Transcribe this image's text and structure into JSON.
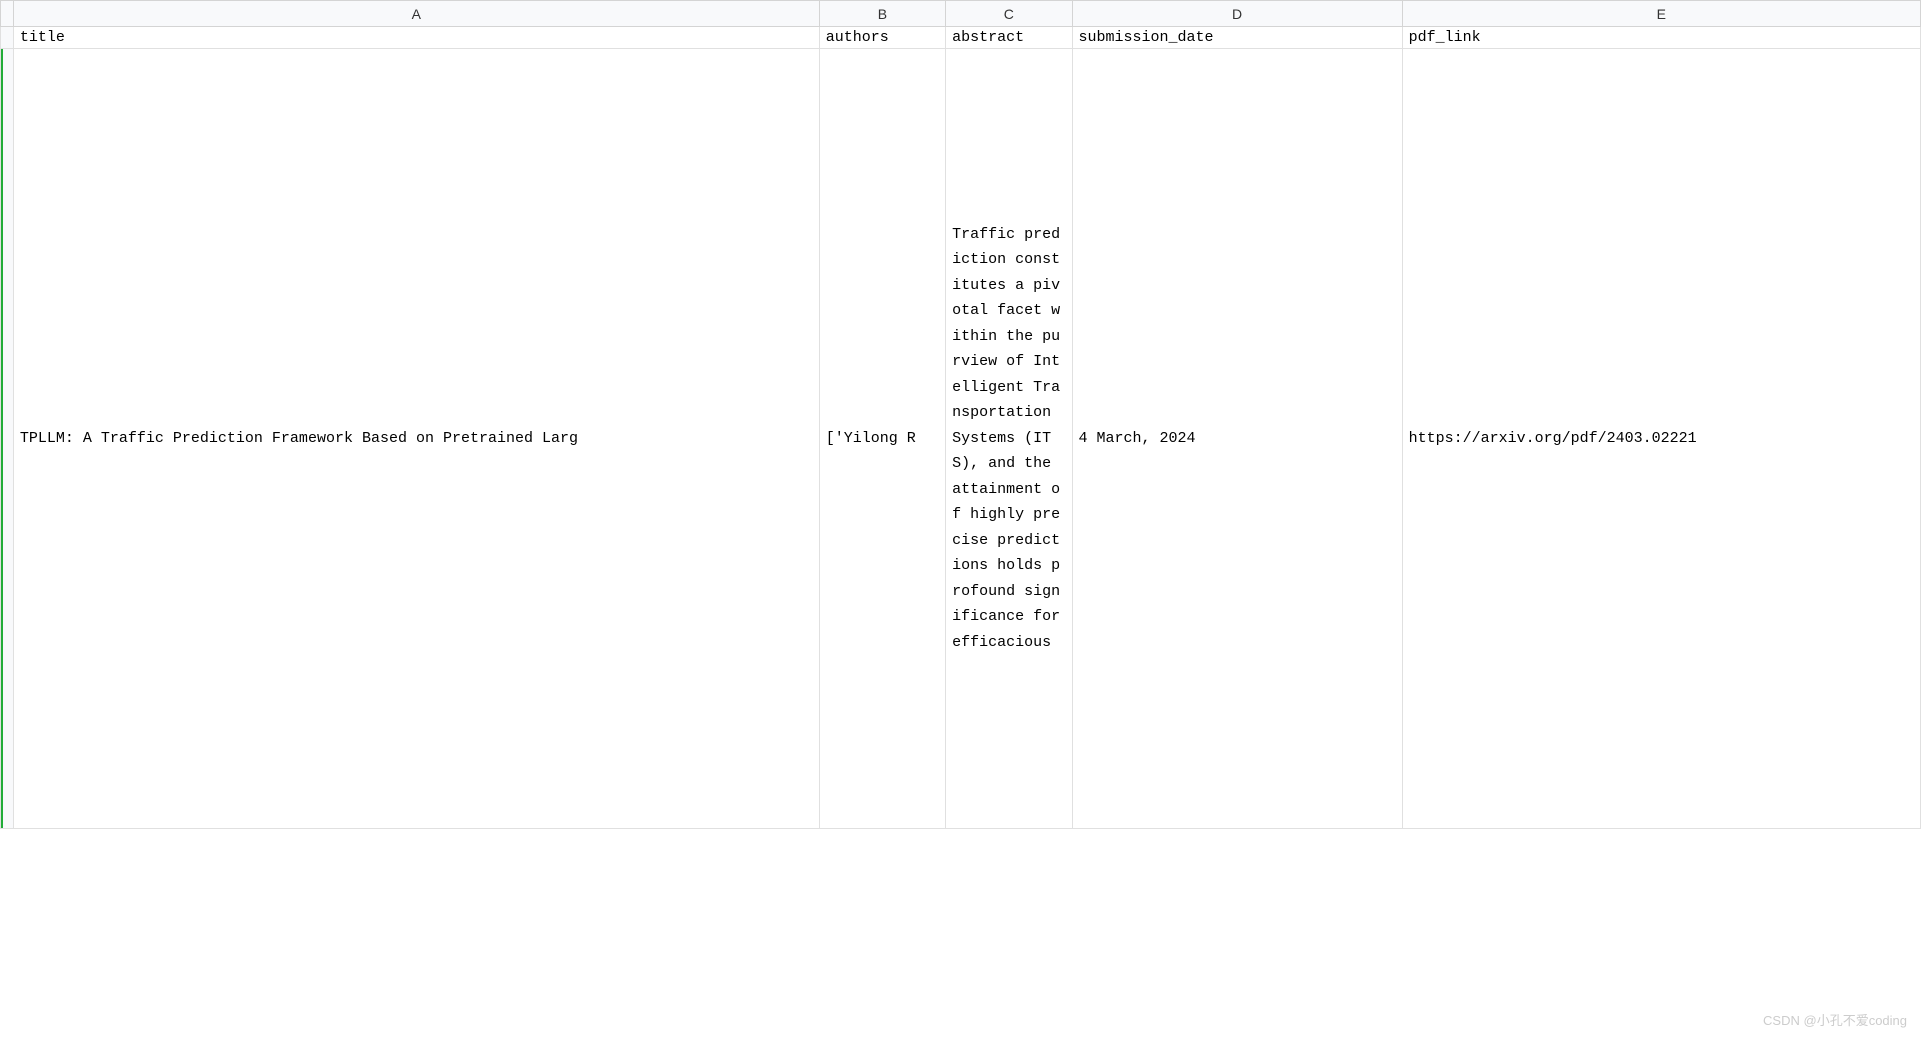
{
  "columns": {
    "A": "A",
    "B": "B",
    "C": "C",
    "D": "D",
    "E": "E"
  },
  "headers": {
    "title": "title",
    "authors": "authors",
    "abstract": "abstract",
    "submission_date": "submission_date",
    "pdf_link": "pdf_link"
  },
  "rows": [
    {
      "title": "TPLLM: A Traffic Prediction Framework Based on Pretrained Larg",
      "authors": "['Yilong R",
      "abstract": "Traffic prediction constitutes a pivotal facet within the purview of Intelligent Transportation Systems (ITS), and the attainment of highly precise predictions holds profound significance for efficacious",
      "submission_date": "4 March, 2024",
      "pdf_link": "https://arxiv.org/pdf/2403.02221"
    }
  ],
  "watermark": "CSDN @小孔不爱coding"
}
